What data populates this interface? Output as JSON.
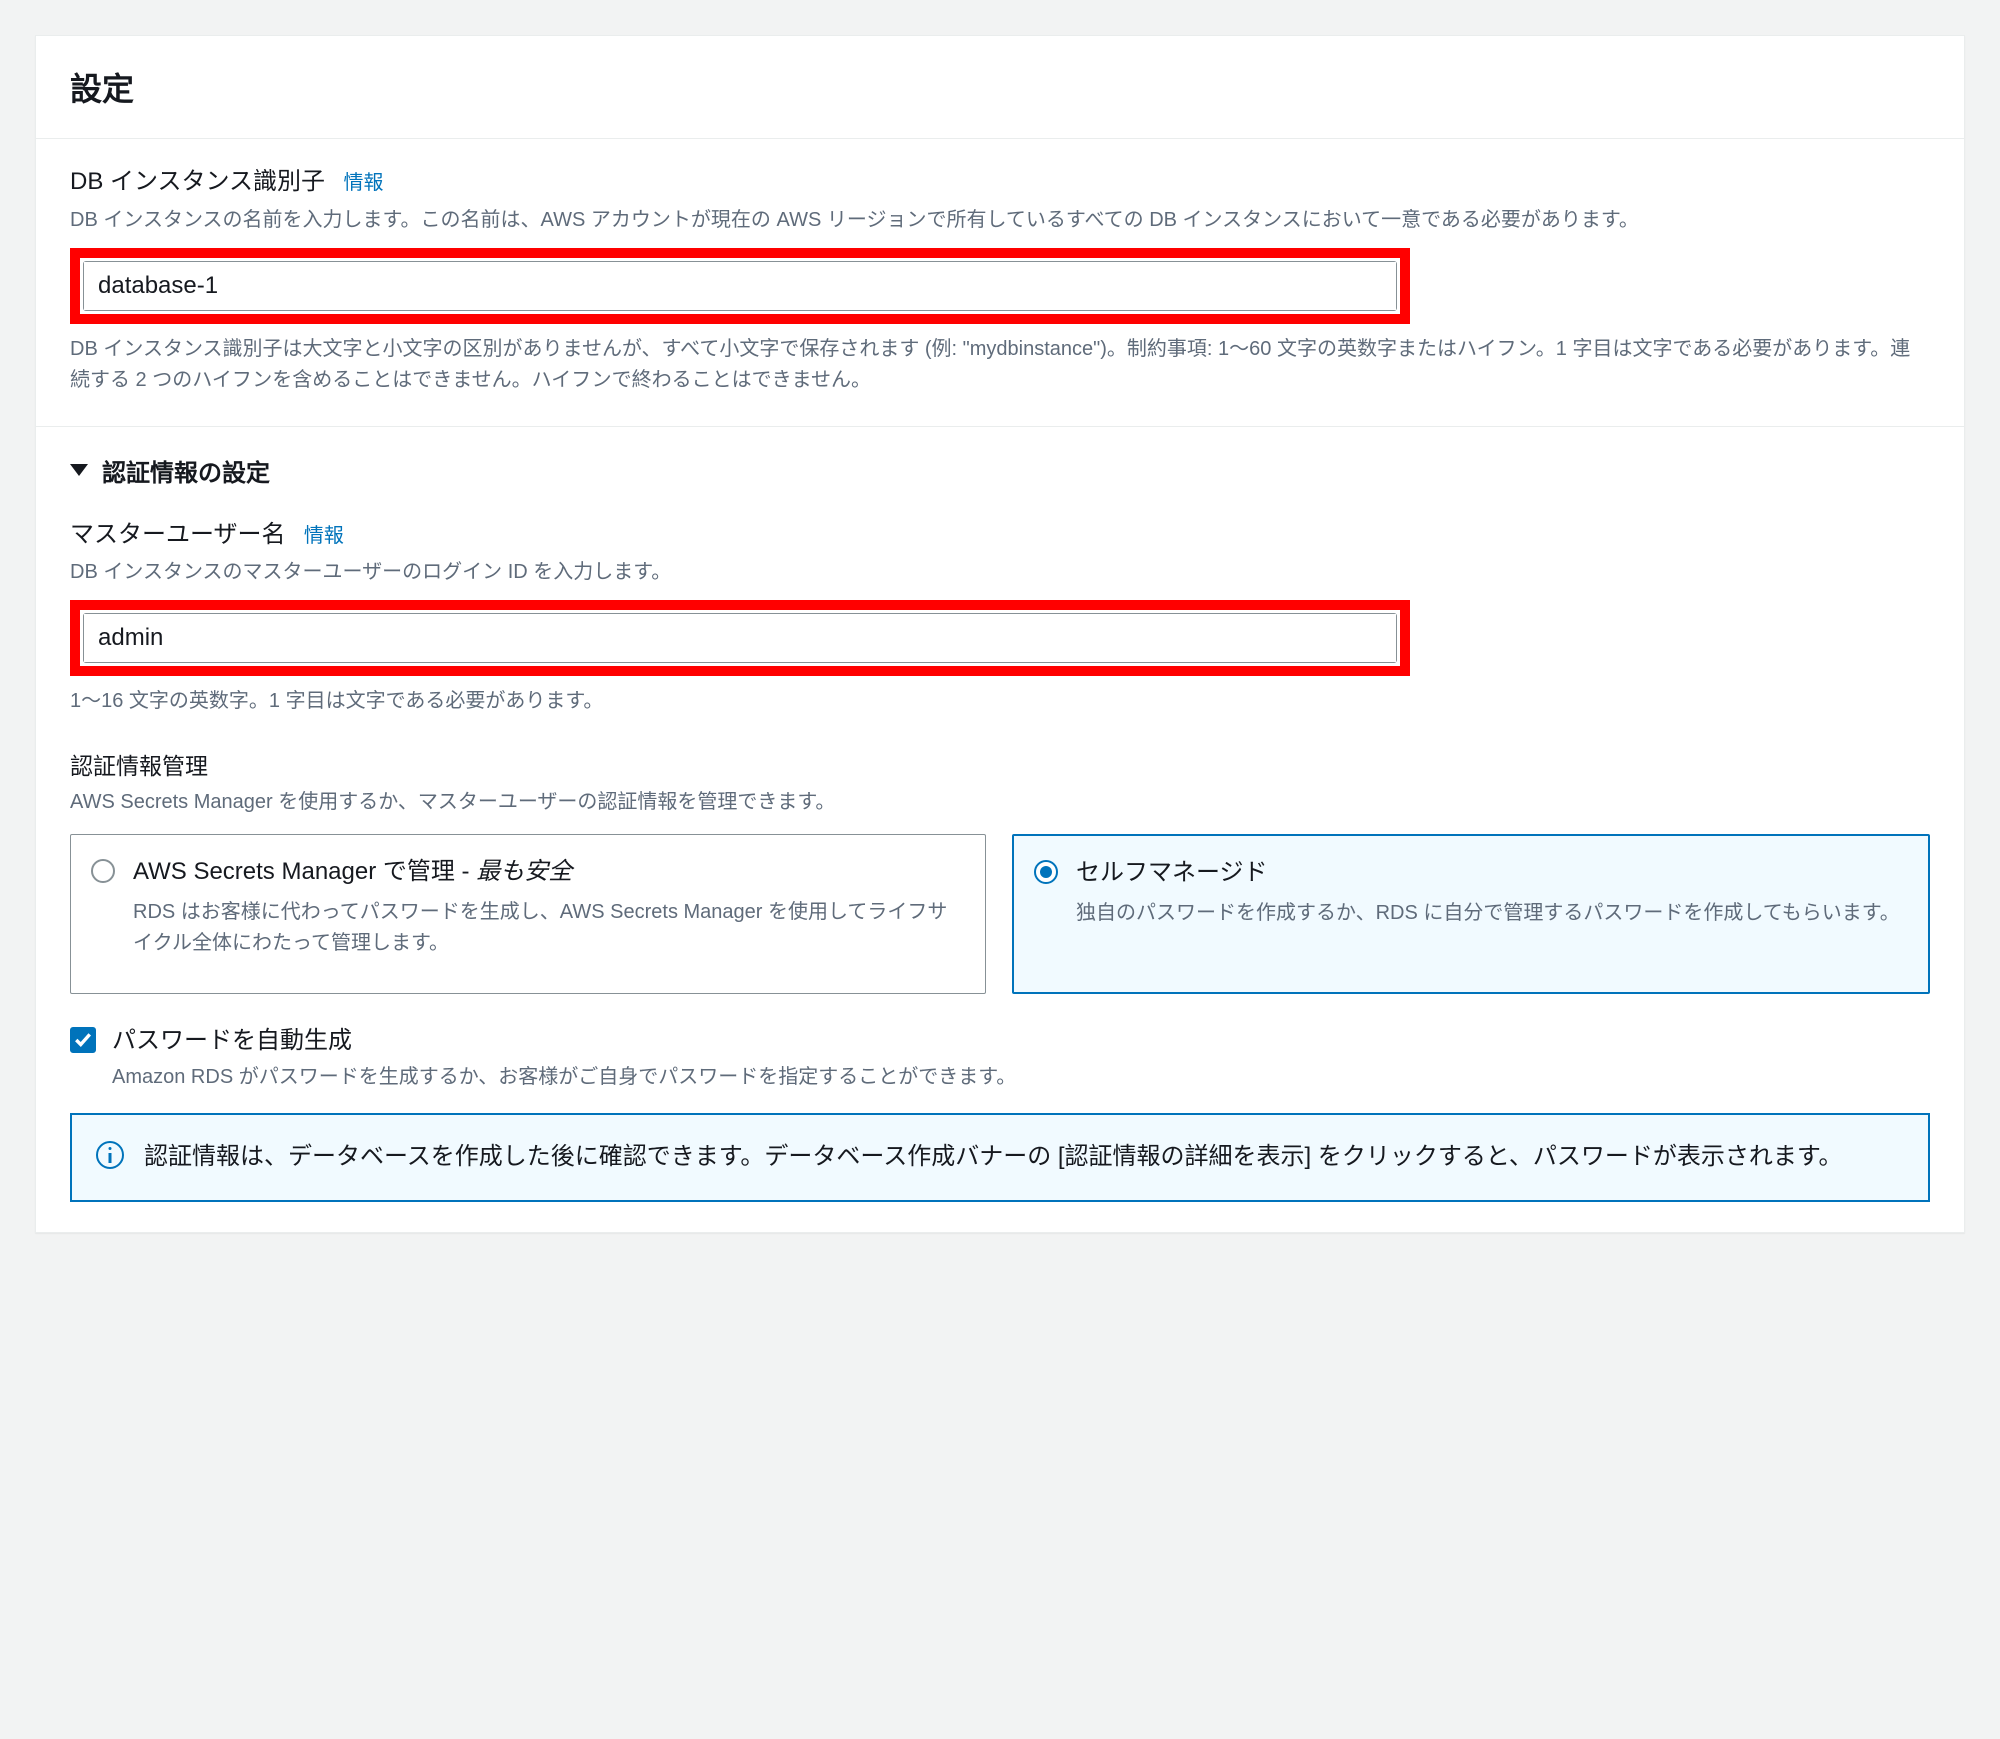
{
  "panel_title": "設定",
  "db_identifier": {
    "label": "DB インスタンス識別子",
    "info": "情報",
    "desc": "DB インスタンスの名前を入力します。この名前は、AWS アカウントが現在の AWS リージョンで所有しているすべての DB インスタンスにおいて一意である必要があります。",
    "value": "database-1",
    "hint": "DB インスタンス識別子は大文字と小文字の区別がありませんが、すべて小文字で保存されます (例: \"mydbinstance\")。制約事項: 1〜60 文字の英数字またはハイフン。1 字目は文字である必要があります。連続する 2 つのハイフンを含めることはできません。ハイフンで終わることはできません。"
  },
  "credentials": {
    "header": "認証情報の設定",
    "master_user": {
      "label": "マスターユーザー名",
      "info": "情報",
      "desc": "DB インスタンスのマスターユーザーのログイン ID を入力します。",
      "value": "admin",
      "hint": "1〜16 文字の英数字。1 字目は文字である必要があります。"
    },
    "management": {
      "title": "認証情報管理",
      "desc": "AWS Secrets Manager を使用するか、マスターユーザーの認証情報を管理できます。",
      "option_secrets_title_a": "AWS Secrets Manager で管理 - ",
      "option_secrets_title_b": "最も安全",
      "option_secrets_desc": "RDS はお客様に代わってパスワードを生成し、AWS Secrets Manager を使用してライフサイクル全体にわたって管理します。",
      "option_self_title": "セルフマネージド",
      "option_self_desc": "独自のパスワードを作成するか、RDS に自分で管理するパスワードを作成してもらいます。"
    },
    "autogen": {
      "label": "パスワードを自動生成",
      "desc": "Amazon RDS がパスワードを生成するか、お客様がご自身でパスワードを指定することができます。"
    },
    "alert": "認証情報は、データベースを作成した後に確認できます。データベース作成バナーの [認証情報の詳細を表示] をクリックすると、パスワードが表示されます。"
  }
}
